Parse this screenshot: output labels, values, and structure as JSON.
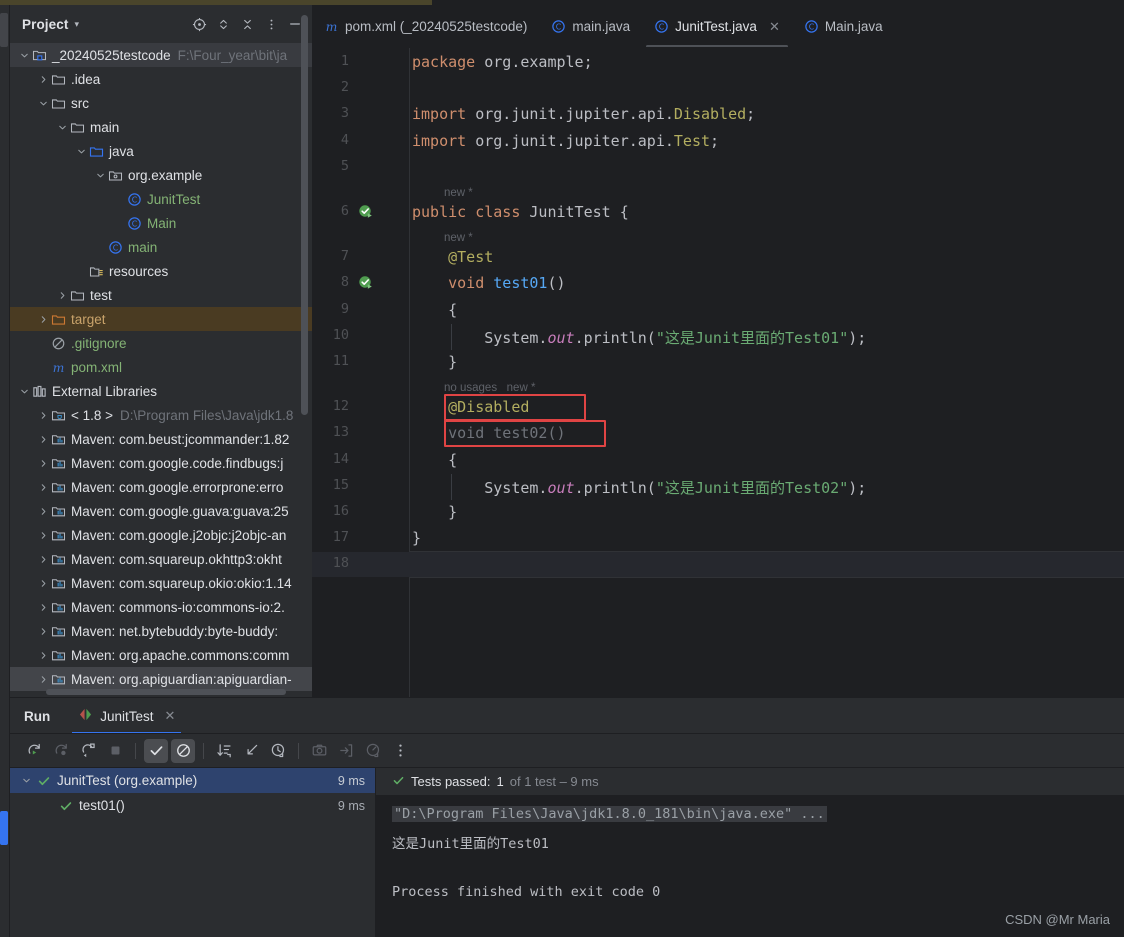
{
  "window": {
    "watermark": "CSDN @Mr Maria"
  },
  "project_panel": {
    "title": "Project",
    "header_icons": [
      "locate-icon",
      "expand-collapse-icon",
      "collapse-all-icon",
      "more-options-icon",
      "hide-panel-icon"
    ],
    "tree": [
      {
        "depth": 0,
        "arrow": "down",
        "icon": "module-folder-icon",
        "label": "_20240525testcode",
        "path": "F:\\Four_year\\bit\\ja",
        "style": "sel-grey"
      },
      {
        "depth": 1,
        "arrow": "right",
        "icon": "folder-icon",
        "label": ".idea",
        "path": "",
        "style": ""
      },
      {
        "depth": 1,
        "arrow": "down",
        "icon": "folder-icon",
        "label": "src",
        "path": "",
        "style": ""
      },
      {
        "depth": 2,
        "arrow": "down",
        "icon": "folder-icon",
        "label": "main",
        "path": "",
        "style": ""
      },
      {
        "depth": 3,
        "arrow": "down",
        "icon": "source-folder-icon",
        "label": "java",
        "path": "",
        "style": ""
      },
      {
        "depth": 4,
        "arrow": "down",
        "icon": "package-icon",
        "label": "org.example",
        "path": "",
        "style": ""
      },
      {
        "depth": 5,
        "arrow": "none",
        "icon": "java-class-icon",
        "label": "JunitTest",
        "path": "",
        "style": "",
        "label_color": "green"
      },
      {
        "depth": 5,
        "arrow": "none",
        "icon": "java-class-icon",
        "label": "Main",
        "path": "",
        "style": "",
        "label_color": "green"
      },
      {
        "depth": 4,
        "arrow": "none",
        "icon": "java-class-icon",
        "label": "main",
        "path": "",
        "style": "",
        "label_color": "green"
      },
      {
        "depth": 3,
        "arrow": "none",
        "icon": "resources-folder-icon",
        "label": "resources",
        "path": "",
        "style": ""
      },
      {
        "depth": 2,
        "arrow": "right",
        "icon": "folder-icon",
        "label": "test",
        "path": "",
        "style": ""
      },
      {
        "depth": 1,
        "arrow": "right",
        "icon": "excluded-folder-icon",
        "label": "target",
        "path": "",
        "style": "sel-amber",
        "label_color": "orange"
      },
      {
        "depth": 1,
        "arrow": "none",
        "icon": "gitignore-icon",
        "label": ".gitignore",
        "path": "",
        "style": "",
        "label_color": "green"
      },
      {
        "depth": 1,
        "arrow": "none",
        "icon": "maven-icon",
        "label": "pom.xml",
        "path": "",
        "style": "",
        "label_color": "green"
      },
      {
        "depth": 0,
        "arrow": "down",
        "icon": "external-libraries-icon",
        "label": "External Libraries",
        "path": "",
        "style": ""
      },
      {
        "depth": 1,
        "arrow": "right",
        "icon": "jdk-icon",
        "label": "< 1.8 >",
        "path": "D:\\Program Files\\Java\\jdk1.8",
        "style": ""
      },
      {
        "depth": 1,
        "arrow": "right",
        "icon": "library-icon",
        "label": "Maven: com.beust:jcommander:1.82",
        "path": "",
        "style": ""
      },
      {
        "depth": 1,
        "arrow": "right",
        "icon": "library-icon",
        "label": "Maven: com.google.code.findbugs:j",
        "path": "",
        "style": ""
      },
      {
        "depth": 1,
        "arrow": "right",
        "icon": "library-icon",
        "label": "Maven: com.google.errorprone:erro",
        "path": "",
        "style": ""
      },
      {
        "depth": 1,
        "arrow": "right",
        "icon": "library-icon",
        "label": "Maven: com.google.guava:guava:25",
        "path": "",
        "style": ""
      },
      {
        "depth": 1,
        "arrow": "right",
        "icon": "library-icon",
        "label": "Maven: com.google.j2objc:j2objc-an",
        "path": "",
        "style": ""
      },
      {
        "depth": 1,
        "arrow": "right",
        "icon": "library-icon",
        "label": "Maven: com.squareup.okhttp3:okht",
        "path": "",
        "style": ""
      },
      {
        "depth": 1,
        "arrow": "right",
        "icon": "library-icon",
        "label": "Maven: com.squareup.okio:okio:1.14",
        "path": "",
        "style": ""
      },
      {
        "depth": 1,
        "arrow": "right",
        "icon": "library-icon",
        "label": "Maven: commons-io:commons-io:2.",
        "path": "",
        "style": ""
      },
      {
        "depth": 1,
        "arrow": "right",
        "icon": "library-icon",
        "label": "Maven: net.bytebuddy:byte-buddy:",
        "path": "",
        "style": ""
      },
      {
        "depth": 1,
        "arrow": "right",
        "icon": "library-icon",
        "label": "Maven: org.apache.commons:comm",
        "path": "",
        "style": ""
      },
      {
        "depth": 1,
        "arrow": "right",
        "icon": "library-icon",
        "label": "Maven: org.apiguardian:apiguardian-",
        "path": "",
        "style": "hl-bar"
      }
    ]
  },
  "editor": {
    "tabs": [
      {
        "icon": "maven-icon",
        "label": "pom.xml (_20240525testcode)",
        "active": false,
        "closable": false
      },
      {
        "icon": "java-class-icon",
        "label": "main.java",
        "active": false,
        "closable": false
      },
      {
        "icon": "java-class-icon",
        "label": "JunitTest.java",
        "active": true,
        "closable": true
      },
      {
        "icon": "java-class-icon",
        "label": "Main.java",
        "active": false,
        "closable": false
      }
    ],
    "gutter_marks": [
      {
        "line": 6,
        "type": "run-test-gutter-icon"
      },
      {
        "line": 8,
        "type": "run-test-gutter-icon"
      }
    ],
    "inlay_hints": [
      {
        "after_line": 5,
        "text": "new *"
      },
      {
        "after_line": 6,
        "text": "new *"
      },
      {
        "after_line": 11,
        "text": "no usages   new *"
      }
    ],
    "lines": [
      {
        "n": 1,
        "tokens": [
          {
            "t": "kw",
            "v": "package"
          },
          {
            "t": "pln",
            "v": " org.example;"
          }
        ]
      },
      {
        "n": 2,
        "tokens": []
      },
      {
        "n": 3,
        "tokens": [
          {
            "t": "kw",
            "v": "import"
          },
          {
            "t": "pln",
            "v": " org.junit.jupiter.api."
          },
          {
            "t": "ann",
            "v": "Disabled"
          },
          {
            "t": "pln",
            "v": ";"
          }
        ]
      },
      {
        "n": 4,
        "tokens": [
          {
            "t": "kw",
            "v": "import"
          },
          {
            "t": "pln",
            "v": " org.junit.jupiter.api."
          },
          {
            "t": "ann",
            "v": "Test"
          },
          {
            "t": "pln",
            "v": ";"
          }
        ]
      },
      {
        "n": 5,
        "tokens": []
      },
      {
        "n": 6,
        "tokens": [
          {
            "t": "kw",
            "v": "public class"
          },
          {
            "t": "pln",
            "v": " JunitTest {"
          }
        ]
      },
      {
        "n": 7,
        "tokens": [
          {
            "t": "pln",
            "v": "    "
          },
          {
            "t": "ann",
            "v": "@Test"
          }
        ]
      },
      {
        "n": 8,
        "tokens": [
          {
            "t": "pln",
            "v": "    "
          },
          {
            "t": "kw",
            "v": "void"
          },
          {
            "t": "pln",
            "v": " "
          },
          {
            "t": "mth",
            "v": "test01"
          },
          {
            "t": "pln",
            "v": "()"
          }
        ]
      },
      {
        "n": 9,
        "tokens": [
          {
            "t": "pln",
            "v": "    {"
          }
        ]
      },
      {
        "n": 10,
        "tokens": [
          {
            "t": "pln",
            "v": "        System."
          },
          {
            "t": "fld",
            "v": "out"
          },
          {
            "t": "pln",
            "v": ".println("
          },
          {
            "t": "str",
            "v": "\"这是Junit里面的Test01\""
          },
          {
            "t": "pln",
            "v": ");"
          }
        ]
      },
      {
        "n": 11,
        "tokens": [
          {
            "t": "pln",
            "v": "    }"
          }
        ]
      },
      {
        "n": 12,
        "tokens": [
          {
            "t": "pln",
            "v": "    "
          },
          {
            "t": "ann",
            "v": "@Disabled"
          }
        ]
      },
      {
        "n": 13,
        "tokens": [
          {
            "t": "pln",
            "v": "    "
          },
          {
            "t": "dim",
            "v": "void"
          },
          {
            "t": "pln",
            "v": " "
          },
          {
            "t": "dim",
            "v": "test02()"
          }
        ]
      },
      {
        "n": 14,
        "tokens": [
          {
            "t": "pln",
            "v": "    {"
          }
        ]
      },
      {
        "n": 15,
        "tokens": [
          {
            "t": "pln",
            "v": "        System."
          },
          {
            "t": "fld",
            "v": "out"
          },
          {
            "t": "pln",
            "v": ".println("
          },
          {
            "t": "str",
            "v": "\"这是Junit里面的Test02\""
          },
          {
            "t": "pln",
            "v": ");"
          }
        ]
      },
      {
        "n": 16,
        "tokens": [
          {
            "t": "pln",
            "v": "    }"
          }
        ]
      },
      {
        "n": 17,
        "tokens": [
          {
            "t": "pln",
            "v": "}"
          }
        ]
      },
      {
        "n": 18,
        "tokens": [],
        "current": true
      }
    ],
    "annotations": [
      {
        "name": "disabled-annotation-highlight",
        "line": 12,
        "color": "#e04444"
      },
      {
        "name": "test02-signature-highlight",
        "line": 13,
        "color": "#e04444"
      }
    ]
  },
  "run_panel": {
    "title": "Run",
    "tab_label": "JunitTest",
    "toolbar": [
      {
        "name": "rerun-icon",
        "state": "enabled"
      },
      {
        "name": "rerun-failed-icon",
        "state": "disabled"
      },
      {
        "name": "toggle-auto-test-icon",
        "state": "enabled"
      },
      {
        "name": "stop-icon",
        "state": "disabled"
      },
      {
        "name": "show-passed-icon",
        "state": "active"
      },
      {
        "name": "show-ignored-icon",
        "state": "active"
      },
      {
        "name": "sort-icon",
        "state": "enabled"
      },
      {
        "name": "expand-collapse-icon",
        "state": "enabled"
      },
      {
        "name": "history-icon",
        "state": "enabled"
      },
      {
        "name": "screenshot-icon",
        "state": "disabled"
      },
      {
        "name": "export-icon",
        "state": "disabled"
      },
      {
        "name": "profile-icon",
        "state": "disabled"
      },
      {
        "name": "more-options-icon",
        "state": "enabled"
      }
    ],
    "tests": [
      {
        "depth": 0,
        "arrow": "down",
        "status": "passed",
        "label": "JunitTest (org.example)",
        "time": "9 ms",
        "selected": true
      },
      {
        "depth": 1,
        "arrow": "none",
        "status": "passed",
        "label": "test01()",
        "time": "9 ms",
        "selected": false
      }
    ],
    "console": {
      "status_prefix": "Tests passed:",
      "status_count": "1",
      "status_suffix": "of 1 test – 9 ms",
      "lines": [
        {
          "text": "\"D:\\Program Files\\Java\\jdk1.8.0_181\\bin\\java.exe\" ...",
          "style": "cmd"
        },
        {
          "text": "这是Junit里面的Test01",
          "style": "plain"
        },
        {
          "text": "",
          "style": "plain"
        },
        {
          "text": "Process finished with exit code 0",
          "style": "plain"
        }
      ]
    }
  }
}
